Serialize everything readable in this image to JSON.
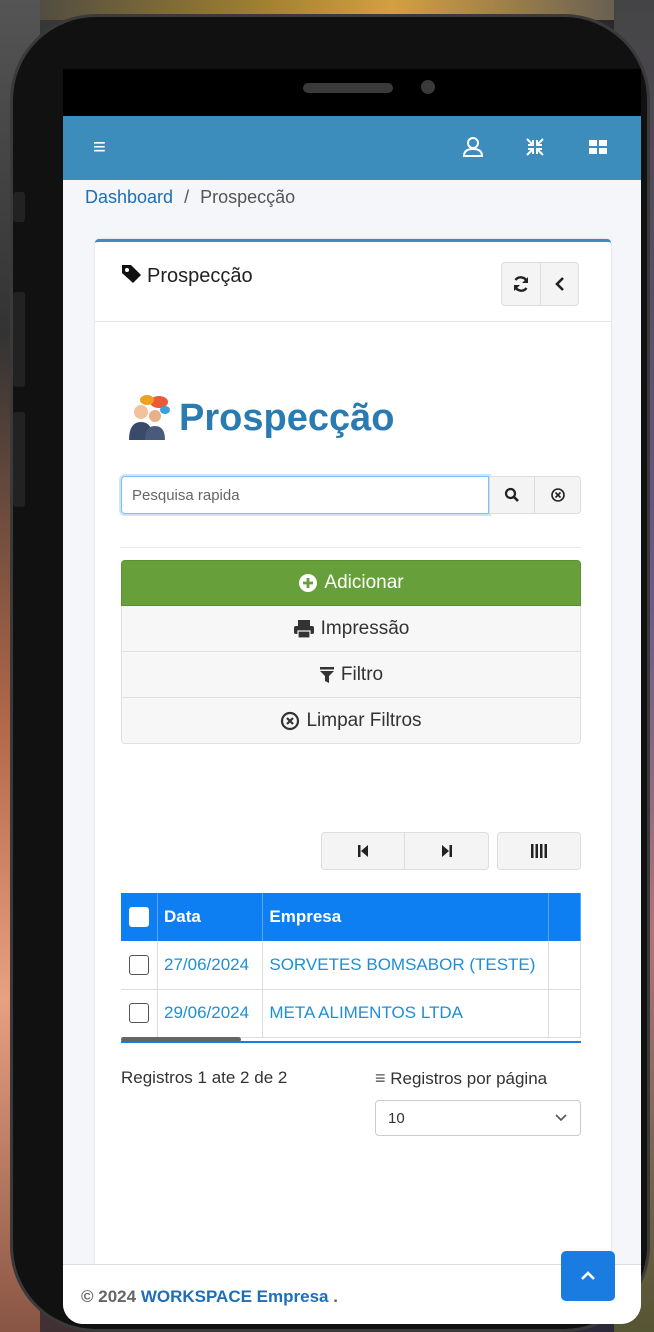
{
  "breadcrumb": {
    "home": "Dashboard",
    "separator": "/",
    "current": "Prospecção"
  },
  "card": {
    "title": "Prospecção"
  },
  "page": {
    "heading": "Prospecção"
  },
  "search": {
    "placeholder": "Pesquisa rapida"
  },
  "actions": {
    "add": "Adicionar",
    "print": "Impressão",
    "filter": "Filtro",
    "clear_filters": "Limpar Filtros"
  },
  "table": {
    "headers": [
      "Data",
      "Empresa"
    ],
    "rows": [
      {
        "date": "27/06/2024",
        "company": "SORVETES BOMSABOR (TESTE)"
      },
      {
        "date": "29/06/2024",
        "company": "META ALIMENTOS LTDA"
      }
    ]
  },
  "records": {
    "summary": "Registros 1 ate 2 de 2",
    "per_page_label": "Registros por página",
    "per_page_value": "10"
  },
  "footer": {
    "prefix": "© 2024",
    "company": "WORKSPACE Empresa",
    "suffix": "."
  },
  "colors": {
    "topbar": "#3c8dbc",
    "add_button": "#67a03a",
    "table_header": "#0e7ff2",
    "link": "#1d6fb8"
  },
  "icons": [
    "menu-icon",
    "user-icon",
    "compress-icon",
    "grid-icon",
    "tag-icon",
    "refresh-icon",
    "chevron-left-icon",
    "search-icon",
    "clear-icon",
    "plus-circle-icon",
    "print-icon",
    "filter-icon",
    "times-circle-icon",
    "first-page-icon",
    "last-page-icon",
    "columns-icon",
    "chevron-up-icon"
  ]
}
